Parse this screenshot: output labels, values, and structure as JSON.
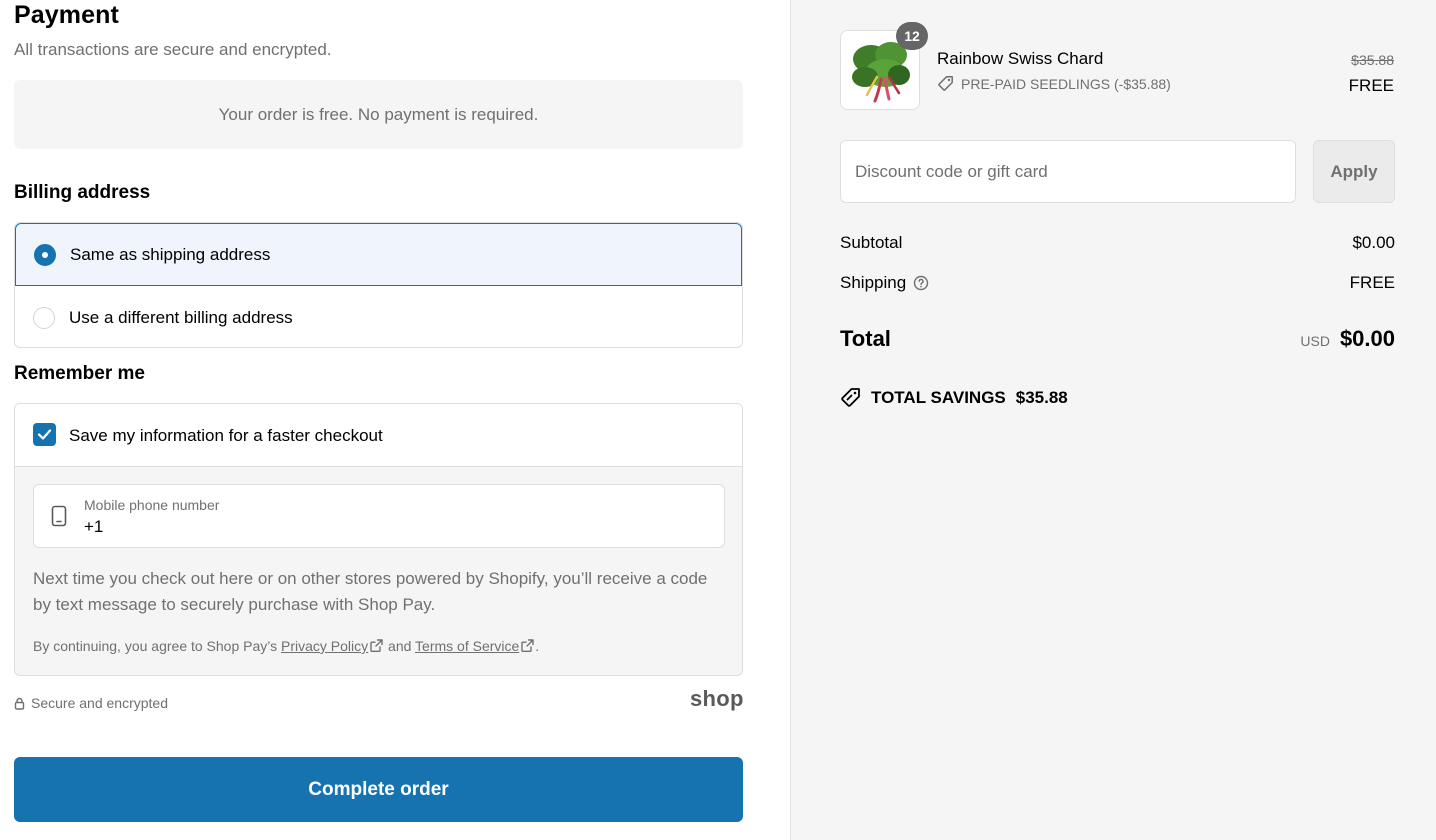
{
  "payment": {
    "title": "Payment",
    "subtitle": "All transactions are secure and encrypted.",
    "free_notice": "Your order is free. No payment is required."
  },
  "billing": {
    "title": "Billing address",
    "options": [
      {
        "label": "Same as shipping address",
        "selected": true
      },
      {
        "label": "Use a different billing address",
        "selected": false
      }
    ]
  },
  "remember": {
    "title": "Remember me",
    "save_label": "Save my information for a faster checkout",
    "save_checked": true,
    "phone_label": "Mobile phone number",
    "phone_value": "+1",
    "note": "Next time you check out here or on other stores powered by Shopify, you’ll receive a code by text message to securely purchase with Shop Pay.",
    "legal_prefix": "By continuing, you agree to Shop Pay’s",
    "privacy_link": "Privacy Policy",
    "legal_and": "and",
    "terms_link": "Terms of Service",
    "legal_suffix": "."
  },
  "secure_text": "Secure and encrypted",
  "shop_logo": "shop",
  "complete_button": "Complete order",
  "summary": {
    "item": {
      "name": "Rainbow Swiss Chard",
      "quantity": "12",
      "discount_tag": "PRE-PAID SEEDLINGS (-$35.88)",
      "original_price": "$35.88",
      "price": "FREE"
    },
    "discount_placeholder": "Discount code or gift card",
    "apply_label": "Apply",
    "subtotal_label": "Subtotal",
    "subtotal_value": "$0.00",
    "shipping_label": "Shipping",
    "shipping_value": "FREE",
    "total_label": "Total",
    "currency": "USD",
    "total_value": "$0.00",
    "savings_label": "TOTAL SAVINGS",
    "savings_value": "$35.88"
  },
  "colors": {
    "accent": "#1773b0",
    "muted_text": "#707070",
    "summary_bg": "#f5f5f5"
  }
}
